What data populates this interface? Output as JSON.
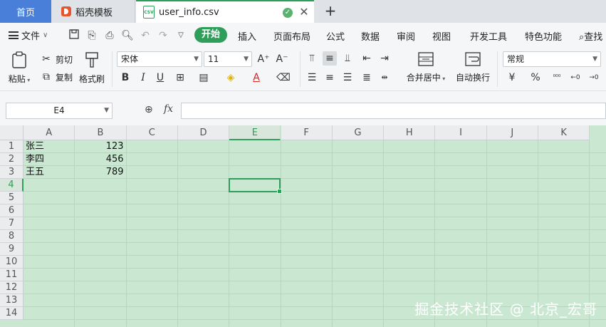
{
  "tabs": {
    "home": "首页",
    "template": "稻壳模板",
    "file": "user_info.csv",
    "file_icon": "CSV"
  },
  "menu": {
    "file": "文件",
    "items": [
      "开始",
      "插入",
      "页面布局",
      "公式",
      "数据",
      "审阅",
      "视图",
      "开发工具",
      "特色功能",
      "查找"
    ]
  },
  "ribbon": {
    "paste": "粘贴",
    "cut": "剪切",
    "copy": "复制",
    "format_painter": "格式刷",
    "font_name": "宋体",
    "font_size": "11",
    "merge_center": "合并居中",
    "wrap_text": "自动换行",
    "number_format": "常规",
    "font_grow": "A⁺",
    "font_shrink": "A⁻",
    "bold": "B",
    "italic": "I",
    "underline": "U",
    "percent": "%"
  },
  "formula_bar": {
    "name_box": "E4",
    "fx": "fx",
    "formula": ""
  },
  "sheet": {
    "columns": [
      "A",
      "B",
      "C",
      "D",
      "E",
      "F",
      "G",
      "H",
      "I",
      "J",
      "K"
    ],
    "rows": [
      "1",
      "2",
      "3",
      "4",
      "5",
      "6",
      "7",
      "8",
      "9",
      "10",
      "11",
      "12",
      "13",
      "14"
    ],
    "selected_column": "E",
    "selected_row": "4",
    "cells": {
      "A1": "张三",
      "B1": "123",
      "A2": "李四",
      "B2": "456",
      "A3": "王五",
      "B3": "789"
    },
    "grid_color": "#cae8d1",
    "accent_color": "#2f9e5a"
  },
  "watermark": "掘金技术社区 @ 北京_宏哥"
}
